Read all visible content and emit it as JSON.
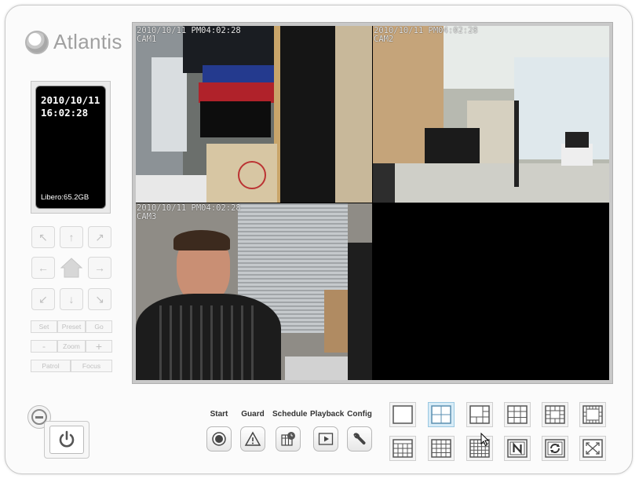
{
  "brand": {
    "name": "Atlantis"
  },
  "status": {
    "date": "2010/10/11",
    "time": "16:02:28",
    "free_space": "Libero:65.2GB"
  },
  "ptz": {
    "arrows": {
      "up_left": "↖",
      "up": "↑",
      "up_right": "↗",
      "left": "←",
      "right": "→",
      "down_left": "↙",
      "down": "↓",
      "down_right": "↘"
    },
    "row1": [
      "Set",
      "Preset",
      "Go"
    ],
    "row2": [
      "-",
      "Zoom",
      "+"
    ],
    "row3": [
      "Patrol",
      "Focus"
    ]
  },
  "cameras": [
    {
      "osd_time": "2010/10/11 PM04:02:28",
      "name": "CAM1"
    },
    {
      "osd_time": "2010/10/11 PM04:02:28",
      "name": "CAM2"
    },
    {
      "osd_time": "2010/10/11 PM04:02:28",
      "name": "CAM3"
    },
    {
      "osd_time": "",
      "name": ""
    }
  ],
  "functions": {
    "start": "Start",
    "guard": "Guard",
    "schedule": "Schedule",
    "playback": "Playback",
    "config": "Config"
  },
  "layouts": {
    "active": "quad",
    "row1": [
      "single",
      "quad",
      "1+5",
      "3x3",
      "1+12",
      "perimeter"
    ],
    "row2": [
      "4x4-a",
      "4x4-b",
      "5x5",
      "N-custom",
      "auto-cycle",
      "fullscreen"
    ]
  },
  "colors": {
    "accent_active": "#d8ecf7",
    "osd_text": "#e8e8e8",
    "status_bg": "#000000"
  }
}
